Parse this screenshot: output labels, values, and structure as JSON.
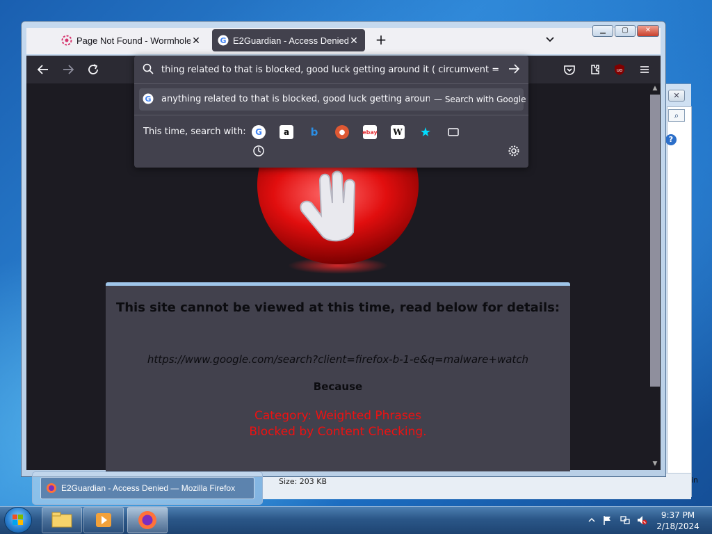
{
  "browser": {
    "tabs": [
      {
        "label": "Page Not Found - Wormhole",
        "active": false
      },
      {
        "label": "E2Guardian - Access Denied",
        "active": true
      }
    ],
    "new_tab_icon": "plus-icon",
    "url_input_value": "thing related to that is blocked, good luck getting around it ( circumvent = ban )",
    "suggestion": {
      "text": "anything related to that is blocked, good luck getting around it",
      "action": "— Search with Google"
    },
    "oneoff": {
      "label": "This time, search with:",
      "engines": [
        "google-icon",
        "amazon-icon",
        "bing-icon",
        "duckduckgo-icon",
        "ebay-icon",
        "wikipedia-icon",
        "bookmarks-star-icon",
        "tabs-icon",
        "history-icon"
      ],
      "settings_icon": "gear-icon"
    }
  },
  "page": {
    "title": "This site cannot be viewed at this time, read below for details:",
    "url": "https://www.google.com/search?client=firefox-b-1-e&q=malware+watch",
    "because": "Because",
    "category_line1": "Category: Weighted Phrases",
    "category_line2": "Blocked by Content Checking."
  },
  "background_window": {
    "size_label": "Size:  203 KB",
    "fragment": "in"
  },
  "taskbar": {
    "preview_label": "E2Guardian - Access Denied — Mozilla Firefox",
    "time": "9:37 PM",
    "date": "2/18/2024"
  },
  "colors": {
    "accent_tab": "#42414d",
    "error_red": "#ee1111",
    "msg_box_border": "#9fc6ea"
  }
}
